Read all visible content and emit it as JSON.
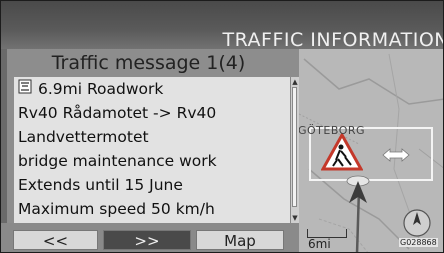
{
  "header": {
    "title": "TRAFFIC INFORMATION"
  },
  "panel": {
    "title": "Traffic message 1(4)",
    "rows": [
      {
        "icon": "roadwork-sign-icon",
        "text": "6.9mi Roadwork"
      },
      {
        "text": "Rv40 Rådamotet -> Rv40"
      },
      {
        "text": "Landvettermotet"
      },
      {
        "text": "bridge maintenance work"
      },
      {
        "text": "Extends until 15 June"
      },
      {
        "text": "Maximum speed 50 km/h"
      }
    ]
  },
  "buttons": {
    "prev_label": "<<",
    "next_label": ">>",
    "map_label": "Map"
  },
  "map": {
    "city_label": "GÖTEBORG",
    "scale_label": "6mi",
    "image_code": "G028868",
    "icons": [
      "roadwork-warning-icon",
      "double-arrow-icon",
      "vehicle-position-icon",
      "compass-icon"
    ]
  },
  "colors": {
    "header_bg": "#555555",
    "list_bg": "#e2e2e2",
    "selected_button_bg": "#4a4a4a",
    "map_bg": "#b6b6b6"
  }
}
